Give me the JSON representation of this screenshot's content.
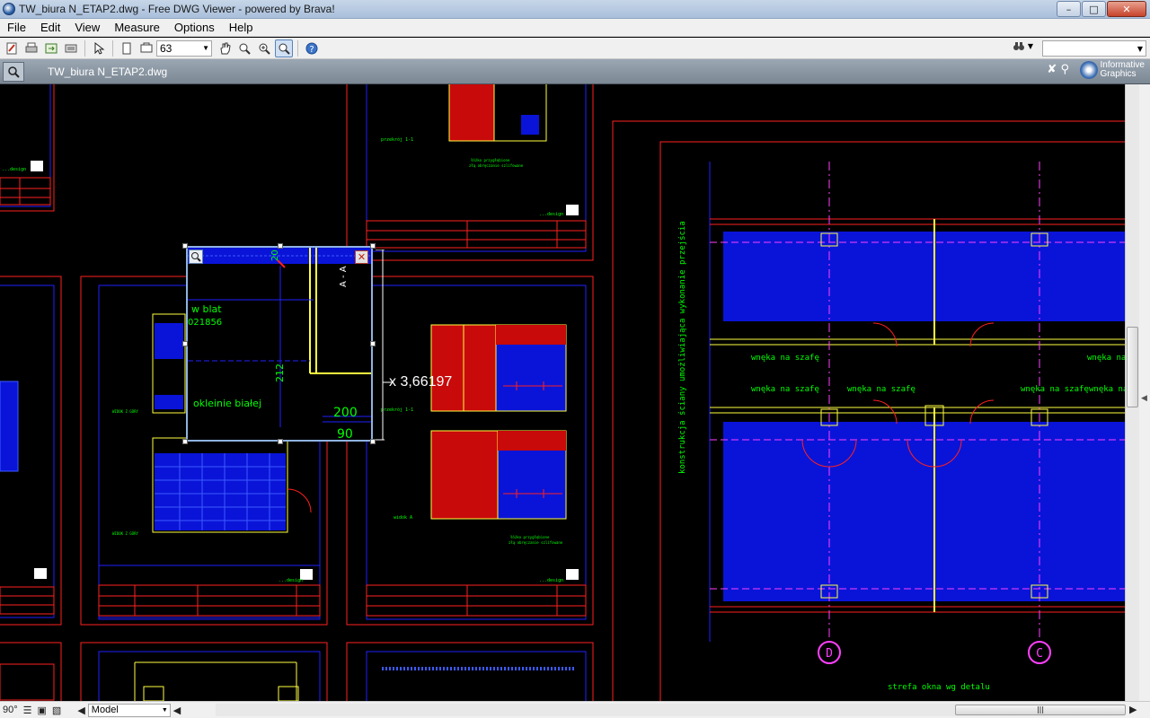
{
  "window": {
    "title": "TW_biura N_ETAP2.dwg - Free DWG Viewer - powered by Brava!"
  },
  "window_controls": {
    "minimize": "–",
    "maximize": "□",
    "close": "✕"
  },
  "menu": [
    "File",
    "Edit",
    "View",
    "Measure",
    "Options",
    "Help"
  ],
  "toolbar": {
    "zoom_value": "63",
    "buttons": [
      "new-icon",
      "print-icon",
      "export-icon",
      "batch-icon",
      "select-icon",
      "page-icon",
      "pages-icon",
      "pan-icon",
      "zoom-window-icon",
      "zoom-icon",
      "magnify-icon",
      "help-icon"
    ]
  },
  "tab": {
    "label": "TW_biura N_ETAP2.dwg"
  },
  "brand": {
    "line1": "Informative",
    "line2": "Graphics"
  },
  "magnifier": {
    "readout": "x 3,66197",
    "texts": {
      "a": "A - A",
      "n20": "20",
      "blat": "w blat",
      "code": "021856",
      "n212": "212",
      "okl": "okleinie białej",
      "n200": "200",
      "n90": "90"
    }
  },
  "drawing": {
    "labels": {
      "przekroj1": "przekrój 1-1",
      "przekroj2": "przekrój 1-1",
      "design1": "...design",
      "design2": "...design",
      "design3": "...design",
      "design4": "...design",
      "widok": "widok A",
      "note1": "łóżko przygłębione\nzłą obrączanie szlifowane",
      "note2": "łóżko przygłębione\nzłą obrączanie szlifowane",
      "vertical": "konstrukcja ściany umożliwiająca wykonanie przejścia",
      "wneka1": "wnęka na szafę",
      "wneka2": "wnęka na szafę",
      "wneka3": "wnęka na szafę",
      "wneka4": "wnęka na szafę",
      "wneka5": "wnęka na szafę",
      "wneka6": "wnęka na szafę",
      "strefa": "strefa okna wg detalu",
      "axisD": "D",
      "axisC": "C"
    }
  },
  "status": {
    "rotation": "90°",
    "layout": "Model"
  },
  "colors": {
    "titlebar": "#b9cce3",
    "canvas": "#000000",
    "red": "#ff2020",
    "blue": "#2020ff",
    "green": "#00ff00",
    "yellow": "#ffff40",
    "magenta": "#ff40ff"
  }
}
